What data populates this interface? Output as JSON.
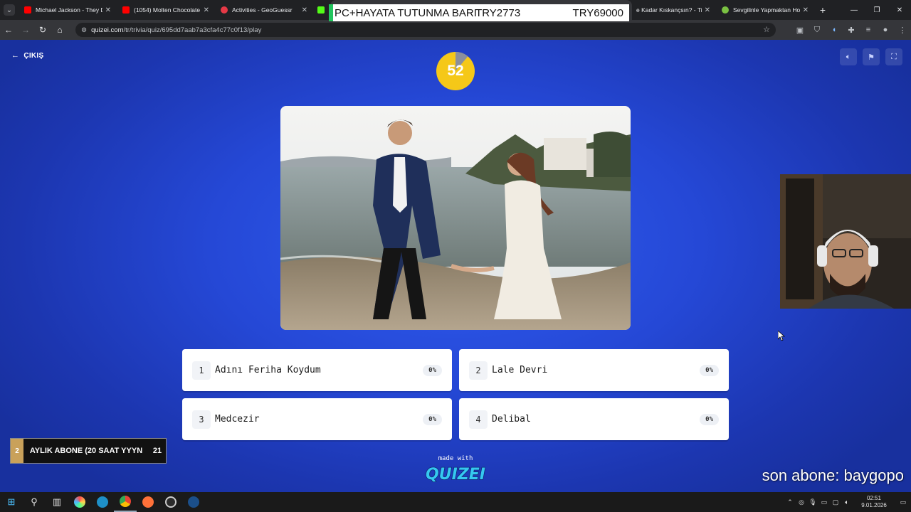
{
  "browser": {
    "tabs": [
      {
        "title": "Michael Jackson - They D",
        "favicon_color": "#ff0000",
        "active": false
      },
      {
        "title": "(1054) Molten Chocolate",
        "favicon_color": "#ff0000",
        "active": false
      },
      {
        "title": "Activities - GeoGuessr",
        "favicon_color": "#e63946",
        "active": false
      },
      {
        "title": "",
        "favicon_color": "#53fc18",
        "active": false
      },
      {
        "title": "",
        "favicon_color": "#4285f4",
        "active": true
      },
      {
        "title": "e Kadar Kıskançsın? - Ti",
        "favicon_color": "#ffffff",
        "active": false
      },
      {
        "title": "Sevgilinle Yapmaktan Ho",
        "favicon_color": "#7ac142",
        "active": false
      }
    ],
    "url_host": "quizei.com",
    "url_path": "/tr/trivia/quiz/695dd7aab7a3cfa4c77c0f13/play"
  },
  "overlay_banner": {
    "left_text": "PC+HAYATA TUTUNMA BARI",
    "middle_text": "TRY2773",
    "right_text": "TRY69000"
  },
  "quiz": {
    "exit_label": "ÇIKIŞ",
    "timer_value": "52",
    "answers": [
      {
        "number": "1",
        "text": "Adını Feriha Koydum",
        "percent": "0%"
      },
      {
        "number": "2",
        "text": "Lale Devri",
        "percent": "0%"
      },
      {
        "number": "3",
        "text": "Medcezir",
        "percent": "0%"
      },
      {
        "number": "4",
        "text": "Delibal",
        "percent": "0%"
      }
    ],
    "made_with": "made with",
    "logo_text": "QUIZEI"
  },
  "stream": {
    "last_sub": "son abone: baygopo",
    "sub_goal_left": "2",
    "sub_goal_text": "AYLIK ABONE (20 SAAT YYYN",
    "sub_goal_right": "21"
  },
  "taskbar": {
    "time": "02:51",
    "date": "9.01.2026"
  },
  "colors": {
    "page_blue": "#2548d6",
    "timer_yellow": "#f5c818",
    "logo_cyan": "#35c8f0"
  }
}
